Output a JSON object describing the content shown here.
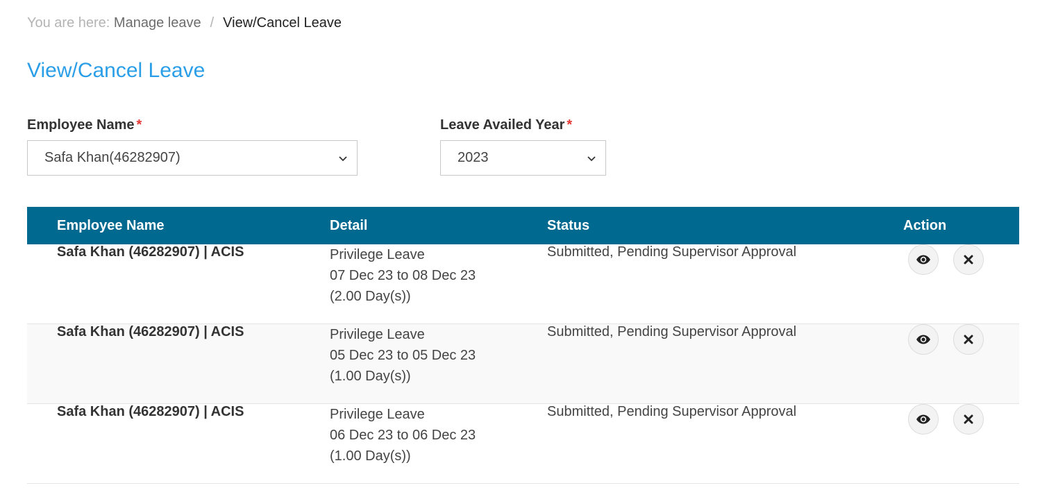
{
  "breadcrumb": {
    "prefix": "You are here:",
    "items": [
      "Manage leave",
      "View/Cancel Leave"
    ],
    "separator": "/"
  },
  "page_title": "View/Cancel Leave",
  "filters": {
    "employee": {
      "label": "Employee Name",
      "required_mark": "*",
      "value": "Safa Khan(46282907)"
    },
    "year": {
      "label": "Leave Availed Year",
      "required_mark": "*",
      "value": "2023"
    }
  },
  "table": {
    "header_color": "#00698f",
    "columns": [
      "Employee Name",
      "Detail",
      "Status",
      "Action"
    ],
    "rows": [
      {
        "employee": "Safa Khan (46282907) | ACIS",
        "leave_type": "Privilege Leave",
        "range": "07 Dec 23 to 08 Dec 23",
        "days": "(2.00 Day(s))",
        "status": "Submitted, Pending Supervisor Approval",
        "actions": [
          "eye-icon",
          "close-icon"
        ]
      },
      {
        "employee": "Safa Khan (46282907) | ACIS",
        "leave_type": "Privilege Leave",
        "range": "05 Dec 23 to 05 Dec 23",
        "days": "(1.00 Day(s))",
        "status": "Submitted, Pending Supervisor Approval",
        "actions": [
          "eye-icon",
          "close-icon"
        ]
      },
      {
        "employee": "Safa Khan (46282907) | ACIS",
        "leave_type": "Privilege Leave",
        "range": "06 Dec 23 to 06 Dec 23",
        "days": "(1.00 Day(s))",
        "status": "Submitted, Pending Supervisor Approval",
        "actions": [
          "eye-icon",
          "close-icon"
        ]
      }
    ]
  },
  "colors": {
    "title": "#2b9ee8",
    "required": "#e53935"
  }
}
